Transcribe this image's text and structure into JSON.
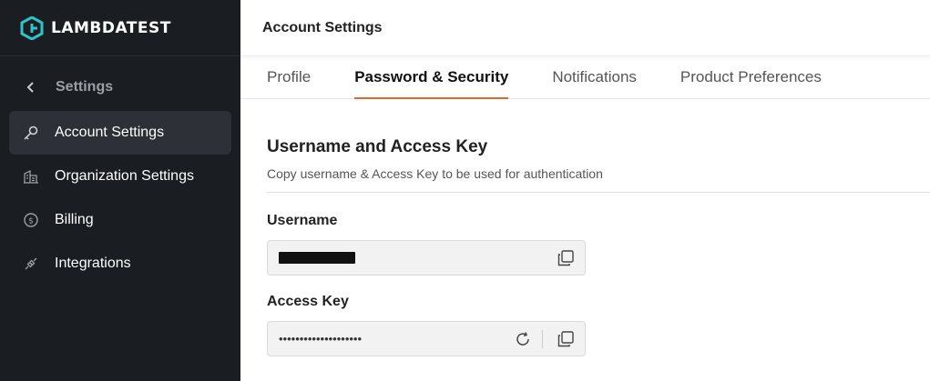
{
  "brand": {
    "name": "LAMBDATEST",
    "accent": "#e0662f",
    "logo_color": "#2ec4c9"
  },
  "sidebar": {
    "back_label": "Settings",
    "items": [
      {
        "label": "Account Settings",
        "icon": "key-icon",
        "active": true
      },
      {
        "label": "Organization Settings",
        "icon": "building-icon",
        "active": false
      },
      {
        "label": "Billing",
        "icon": "dollar-circle-icon",
        "active": false
      },
      {
        "label": "Integrations",
        "icon": "plug-icon",
        "active": false
      }
    ]
  },
  "header": {
    "title": "Account Settings"
  },
  "tabs": [
    {
      "label": "Profile",
      "active": false
    },
    {
      "label": "Password & Security",
      "active": true
    },
    {
      "label": "Notifications",
      "active": false
    },
    {
      "label": "Product Preferences",
      "active": false
    }
  ],
  "section": {
    "title": "Username and Access Key",
    "subtitle": "Copy username & Access Key to be used for authentication"
  },
  "username": {
    "label": "Username"
  },
  "access_key": {
    "label": "Access Key",
    "value": "••••••••••••••••••••"
  }
}
